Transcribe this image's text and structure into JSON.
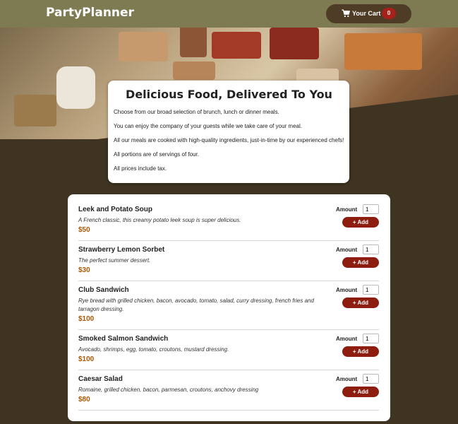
{
  "app": {
    "brand": "PartyPlanner"
  },
  "cart": {
    "label": "Your Cart",
    "count": "0",
    "icon": "cart-icon"
  },
  "intro": {
    "title": "Delicious Food, Delivered To You",
    "paragraphs": [
      "Choose from our broad selection of brunch, lunch or dinner meals.",
      "You can enjoy the company of your guests while we take care of your meal.",
      "All our meals are cooked with high-quality ingredients, just-in-time by our experienced chefs!",
      "All portions are of servings of four.",
      "All prices include tax."
    ]
  },
  "menu": {
    "amount_label": "Amount",
    "add_label": "+ Add",
    "meals": [
      {
        "name": "Leek and Potato Soup",
        "description": "A French classic, this creamy potato leek soup is super delicious.",
        "price": "$50",
        "amount": "1"
      },
      {
        "name": "Strawberry Lemon Sorbet",
        "description": "The perfect summer dessert.",
        "price": "$30",
        "amount": "1"
      },
      {
        "name": "Club Sandwich",
        "description": "Rye bread with grilled chicken, bacon, avocado, tomato, salad, curry dressing, french fries and tarragon dressing.",
        "price": "$100",
        "amount": "1"
      },
      {
        "name": "Smoked Salmon Sandwich",
        "description": "Avocado, shrimps, egg, tomato, croutons, mustard dressing.",
        "price": "$100",
        "amount": "1"
      },
      {
        "name": "Caesar Salad",
        "description": "Romaine, grilled chicken, bacon, parmesan, croutons, anchovy dressing",
        "price": "$80",
        "amount": "1"
      }
    ]
  },
  "colors": {
    "header": "#7e7b52",
    "background": "#3f3322",
    "cart_button": "#4e3c26",
    "badge": "#a7211a",
    "add_button": "#8c1d0f",
    "price": "#ad5502"
  }
}
